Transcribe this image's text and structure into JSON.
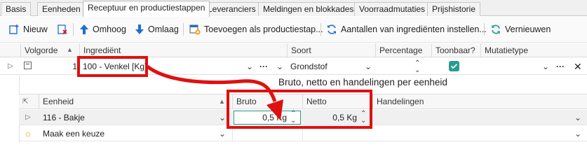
{
  "tabs": [
    "Basis",
    "Eenheden",
    "Receptuur en productiestappen",
    "Leveranciers",
    "Meldingen en blokkades",
    "Voorraadmutaties",
    "Prijshistorie"
  ],
  "active_tab_index": 2,
  "toolbar": {
    "new_label": "Nieuw",
    "up_label": "Omhoog",
    "down_label": "Omlaag",
    "add_step_label": "Toevoegen als productiestap...",
    "update_amounts_label": "Aantallen van ingrediënten instellen...",
    "refresh_label": "Vernieuwen"
  },
  "grid": {
    "columns": [
      "Volgorde",
      "Ingrediënt",
      "Soort",
      "Percentage",
      "Toonbaar?",
      "Mutatietype"
    ],
    "row": {
      "order": "1",
      "ingredient": "100 - Venkel  [Kg]",
      "kind": "Grondstof",
      "percentage": "",
      "showable": true,
      "mutation_type": ""
    }
  },
  "annotation": "Bruto, netto en handelingen per eenheid",
  "detail": {
    "columns": [
      "Eenheid",
      "Bruto",
      "Netto",
      "Handelingen"
    ],
    "rows": [
      {
        "unit": "116 - Bakje",
        "bruto": "0,5 Kg",
        "netto": "0,5 Kg",
        "handelingen": ""
      }
    ],
    "new_row_placeholder": "Maak een keuze"
  },
  "colors": {
    "accent": "#2a9d8f",
    "highlight": "#e01010",
    "toolbar_blue": "#1e6fd0"
  }
}
